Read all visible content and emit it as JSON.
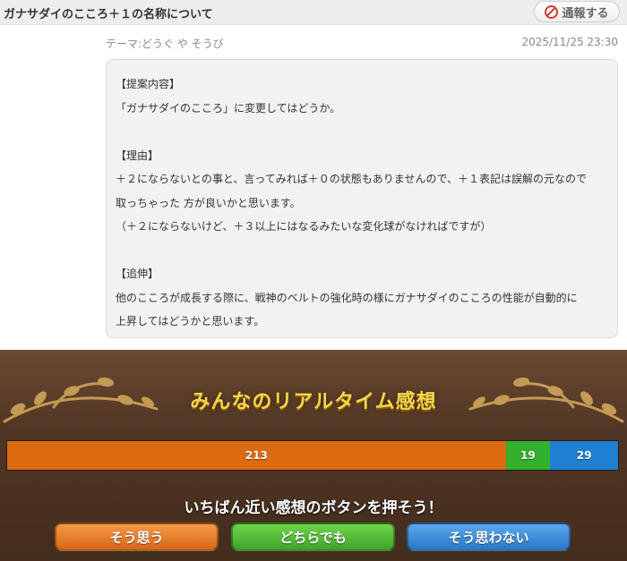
{
  "header": {
    "title": "ガナサダイのこころ＋１の名称について",
    "report_label": "通報する"
  },
  "post": {
    "theme": "テーマ:どうぐ や そうび",
    "date": "2025/11/25 23:30",
    "lines": [
      "【提案内容】",
      "「ガナサダイのこころ」に変更してはどうか。",
      "",
      "【理由】",
      "＋２にならないとの事と、言ってみれば＋０の状態もありませんので、＋１表記は誤解の元なので",
      "取っちゃった 方が良いかと思います。",
      "（＋２にならないけど、＋３以上にはなるみたいな変化球がなければですが）",
      "",
      "【追伸】",
      "他のこころが成長する際に、戦神のベルトの強化時の様にガナサダイのこころの性能が自動的に",
      "上昇してはどうかと思います。"
    ]
  },
  "reactions": {
    "heading": "みんなのリアルタイム感想",
    "prompt": "いちばん近い感想のボタンを押そう！",
    "counts": {
      "agree": "213",
      "neutral": "19",
      "disagree": "29"
    },
    "colors": {
      "agree": "#dc6a10",
      "neutral": "#33b02d",
      "disagree": "#1f7fd0"
    },
    "buttons": {
      "agree": "そう思う",
      "neutral": "どちらでも",
      "disagree": "そう思わない"
    }
  }
}
